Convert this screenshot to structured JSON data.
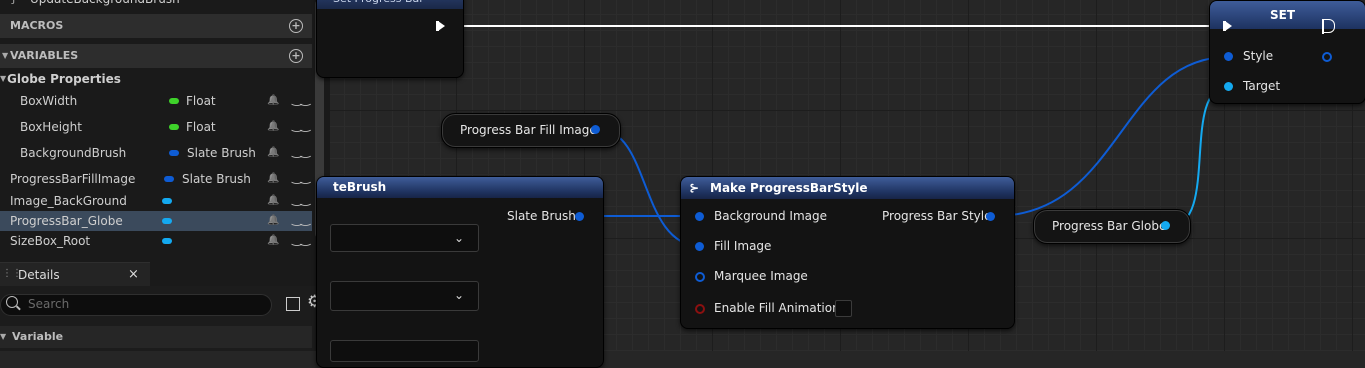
{
  "left_panel": {
    "top_item": "UpdateBackgroundBrush",
    "macros_label": "MACROS",
    "variables_label": "VARIABLES",
    "globe_properties_label": "Globe Properties",
    "variables": [
      {
        "name": "BoxWidth",
        "type": "Float",
        "color": "#3ed22a"
      },
      {
        "name": "BoxHeight",
        "type": "Float",
        "color": "#3ed22a"
      },
      {
        "name": "BackgroundBrush",
        "type": "Slate Brush",
        "color": "#0e5cd4"
      },
      {
        "name": "ProgressBarFillImage",
        "type": "Slate Brush",
        "color": "#0e5cd4"
      },
      {
        "name": "Image_BackGround",
        "type": "",
        "color": "#14a9f0"
      },
      {
        "name": "ProgressBar_Globe",
        "type": "",
        "color": "#14a9f0"
      },
      {
        "name": "SizeBox_Root",
        "type": "",
        "color": "#14a9f0"
      }
    ],
    "details_tab": "Details",
    "details_close": "×",
    "search_placeholder": "Search",
    "variable_section": "Variable"
  },
  "graph": {
    "top_node_title": "Set Progress Bar",
    "set_node": {
      "title": "SET",
      "style_pin": "Style",
      "target_pin": "Target"
    },
    "fill_image_var": "Progress Bar Fill Image",
    "slate_brush_node": {
      "title": "teBrush",
      "output_pin": "Slate Brush"
    },
    "make_node": {
      "title": "Make ProgressBarStyle",
      "inputs": [
        "Background Image",
        "Fill Image",
        "Marquee Image",
        "Enable Fill Animation"
      ],
      "output": "Progress Bar Style"
    },
    "globe_var": "Progress Bar Globe"
  },
  "colors": {
    "struct_pin": "#0e5cd4",
    "object_pin": "#14a9f0",
    "float_pin": "#3ed22a",
    "bool_pin": "#8b1010",
    "node_header": "#2a4175"
  }
}
